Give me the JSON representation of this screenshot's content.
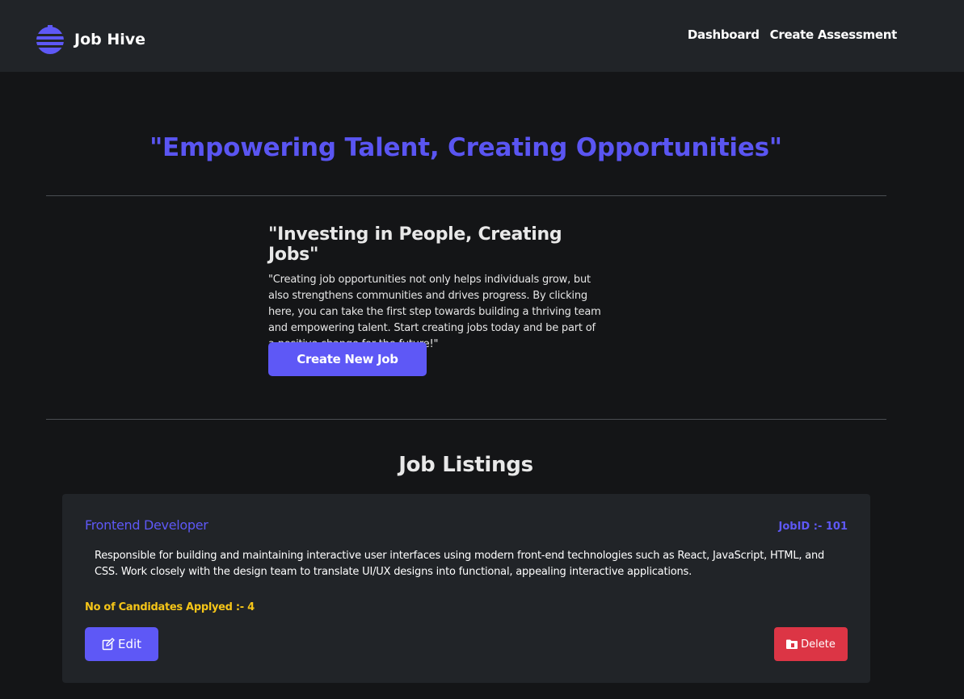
{
  "brand": {
    "name": "Job Hive",
    "logo_icon": "beehive-logo-icon"
  },
  "nav": {
    "items": [
      {
        "label": "Dashboard"
      },
      {
        "label": "Create Assessment"
      }
    ]
  },
  "hero": {
    "title": "\"Empowering Talent, Creating Opportunities\""
  },
  "invest": {
    "title": "\"Investing in People, Creating Jobs\"",
    "text": "\"Creating job opportunities not only helps individuals grow, but also strengthens communities and drives progress. By clicking here, you can take the first step towards building a thriving team and empowering talent. Start creating jobs today and be part of a positive change for the future!\"",
    "button_label": "Create New Job"
  },
  "listings": {
    "title": "Job Listings",
    "jobs": [
      {
        "title": "Frontend Developer",
        "job_id": "JobID :- 101",
        "description": "Responsible for building and maintaining interactive user interfaces using modern front-end technologies such as React, JavaScript, HTML, and CSS. Work closely with the design team to translate UI/UX designs into functional, appealing interactive applications.",
        "candidates": "No of Candidates Applyed :- 4",
        "edit_label": "Edit",
        "edit_icon": "edit-icon",
        "delete_label": "Delete",
        "delete_icon": "folder-delete-icon"
      }
    ]
  },
  "colors": {
    "accent": "#5e58f6",
    "danger": "#dc3545",
    "warning": "#f5c518",
    "navbar_bg": "#212428",
    "page_bg": "#141517"
  }
}
